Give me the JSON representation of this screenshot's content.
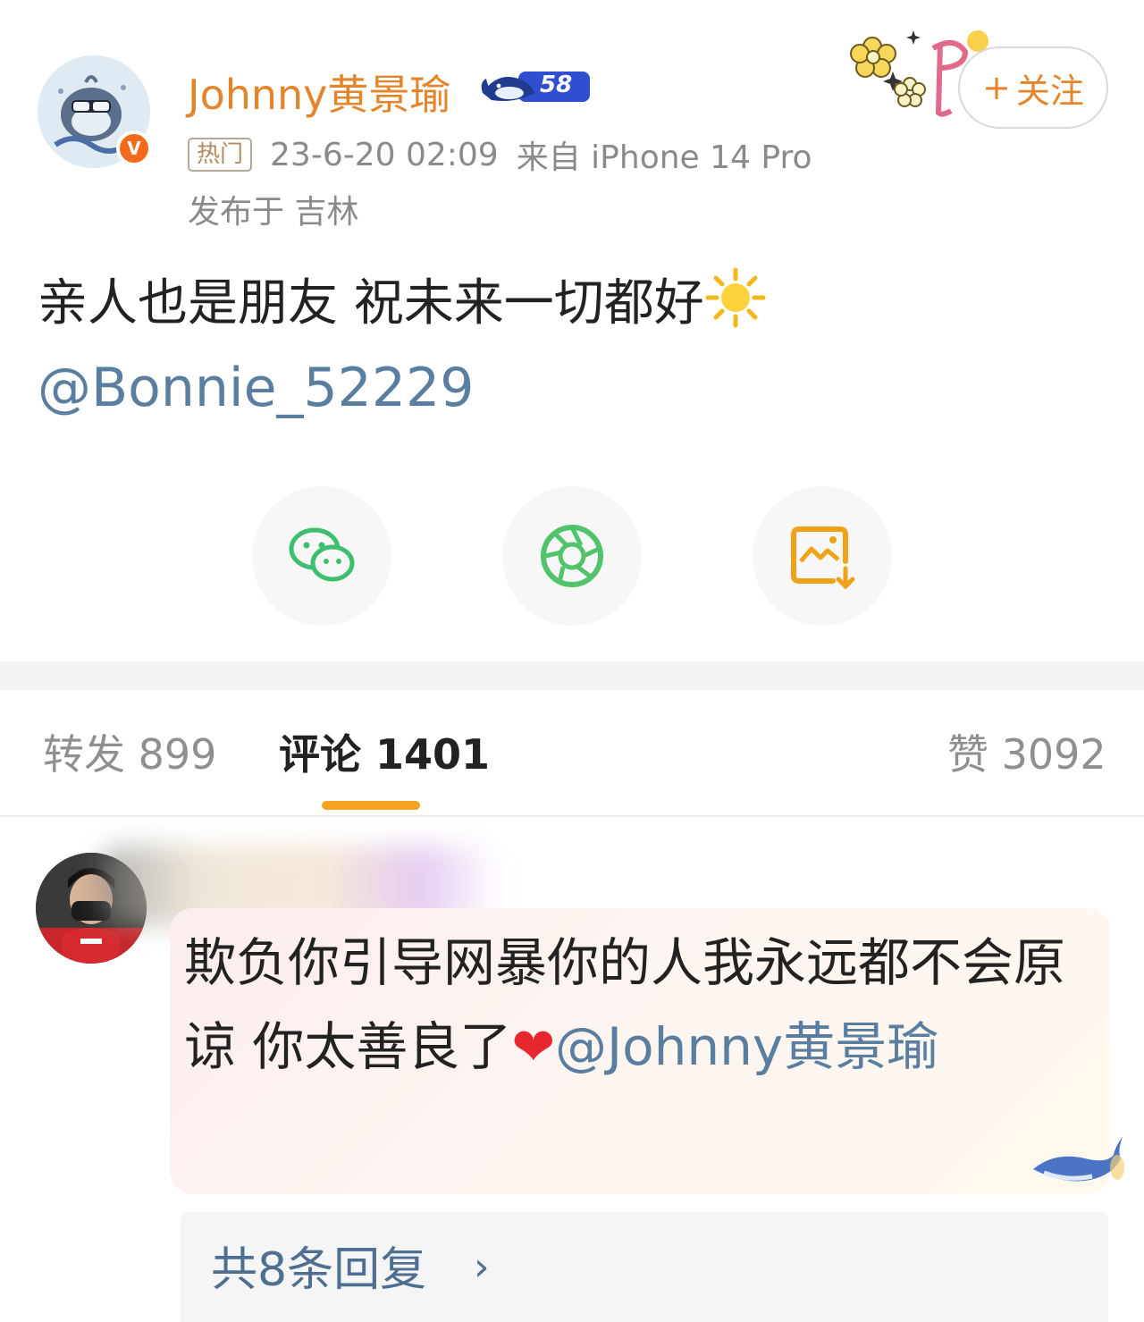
{
  "author": {
    "name": "Johnny黄景瑜",
    "level": "58",
    "verify_mark": "V"
  },
  "meta": {
    "hot_tag": "热门",
    "timestamp": "23-6-20 02:09",
    "source": "来自 iPhone 14 Pro",
    "location": "发布于 吉林"
  },
  "follow_button": {
    "plus": "+",
    "label": "关注"
  },
  "post": {
    "text": "亲人也是朋友 祝未来一切都好",
    "mention": "@Bonnie_52229",
    "emoji": "sun-emoji"
  },
  "share": {
    "icons": [
      "wechat-icon",
      "moments-icon",
      "save-image-icon"
    ]
  },
  "tabs": {
    "repost": "转发 899",
    "comments": "评论 1401",
    "likes": "赞 3092",
    "active": "comments"
  },
  "comment": {
    "text": "欺负你引导网暴你的人我永远都不会原谅 你太善良了",
    "heart": "❤",
    "mention": "@Johnny黄景瑜",
    "replies_label": "共8条回复",
    "replies_chevron": "›"
  },
  "colors": {
    "accent": "#e3852b",
    "link": "#5a7ea0",
    "tab_underline": "#f4a420",
    "wechat": "#3dbf6f",
    "moments": "#52c36a",
    "save": "#f0a31a"
  }
}
